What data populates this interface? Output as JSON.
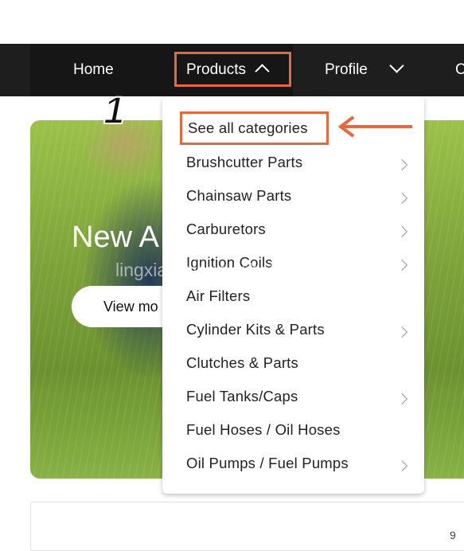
{
  "nav": {
    "home": "Home",
    "products": "Products",
    "profile": "Profile",
    "more": "C"
  },
  "annotation": {
    "step_number": "1"
  },
  "hero": {
    "title": "New A",
    "button": "View mo"
  },
  "watermark": "lingxiaomy.en.alibaba.com",
  "dropdown": {
    "items": [
      {
        "label": "See all categories",
        "has_submenu": false
      },
      {
        "label": "Brushcutter Parts",
        "has_submenu": true
      },
      {
        "label": "Chainsaw Parts",
        "has_submenu": true
      },
      {
        "label": "Carburetors",
        "has_submenu": true
      },
      {
        "label": "Ignition Coils",
        "has_submenu": true
      },
      {
        "label": "Air Filters",
        "has_submenu": false
      },
      {
        "label": "Cylinder Kits & Parts",
        "has_submenu": true
      },
      {
        "label": "Clutches & Parts",
        "has_submenu": false
      },
      {
        "label": "Fuel Tanks/Caps",
        "has_submenu": true
      },
      {
        "label": "Fuel Hoses / Oil Hoses",
        "has_submenu": false
      },
      {
        "label": "Oil Pumps / Fuel  Pumps",
        "has_submenu": true
      }
    ]
  },
  "footer_fragment": "9",
  "colors": {
    "highlight": "#e4693c",
    "navbar": "#1e1e1e"
  }
}
